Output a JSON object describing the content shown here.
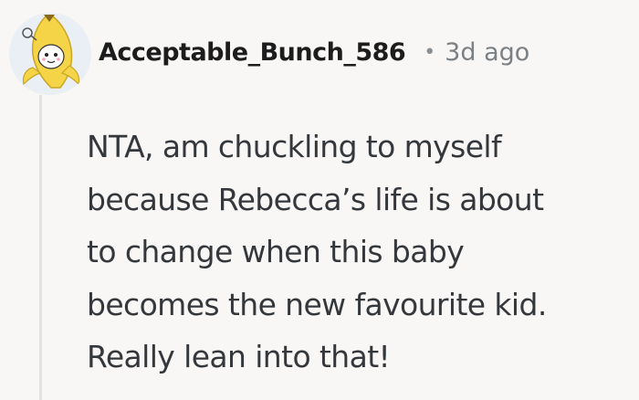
{
  "comment": {
    "username": "Acceptable_Bunch_586",
    "separator": "•",
    "timestamp": "3d ago",
    "body_lines": [
      "NTA, am chuckling to myself",
      "because Rebecca’s life is about",
      "to change when this baby",
      "becomes the new favourite kid.",
      "Really lean into that!"
    ]
  },
  "avatar": {
    "icon": "banana-costume-avatar-icon",
    "background_color": "#e9eff5",
    "accent_color": "#f5d547"
  },
  "colors": {
    "background": "#f8f7f5",
    "thread_line": "#e3e1dd",
    "text": "#34383c",
    "meta": "#7b8085"
  }
}
